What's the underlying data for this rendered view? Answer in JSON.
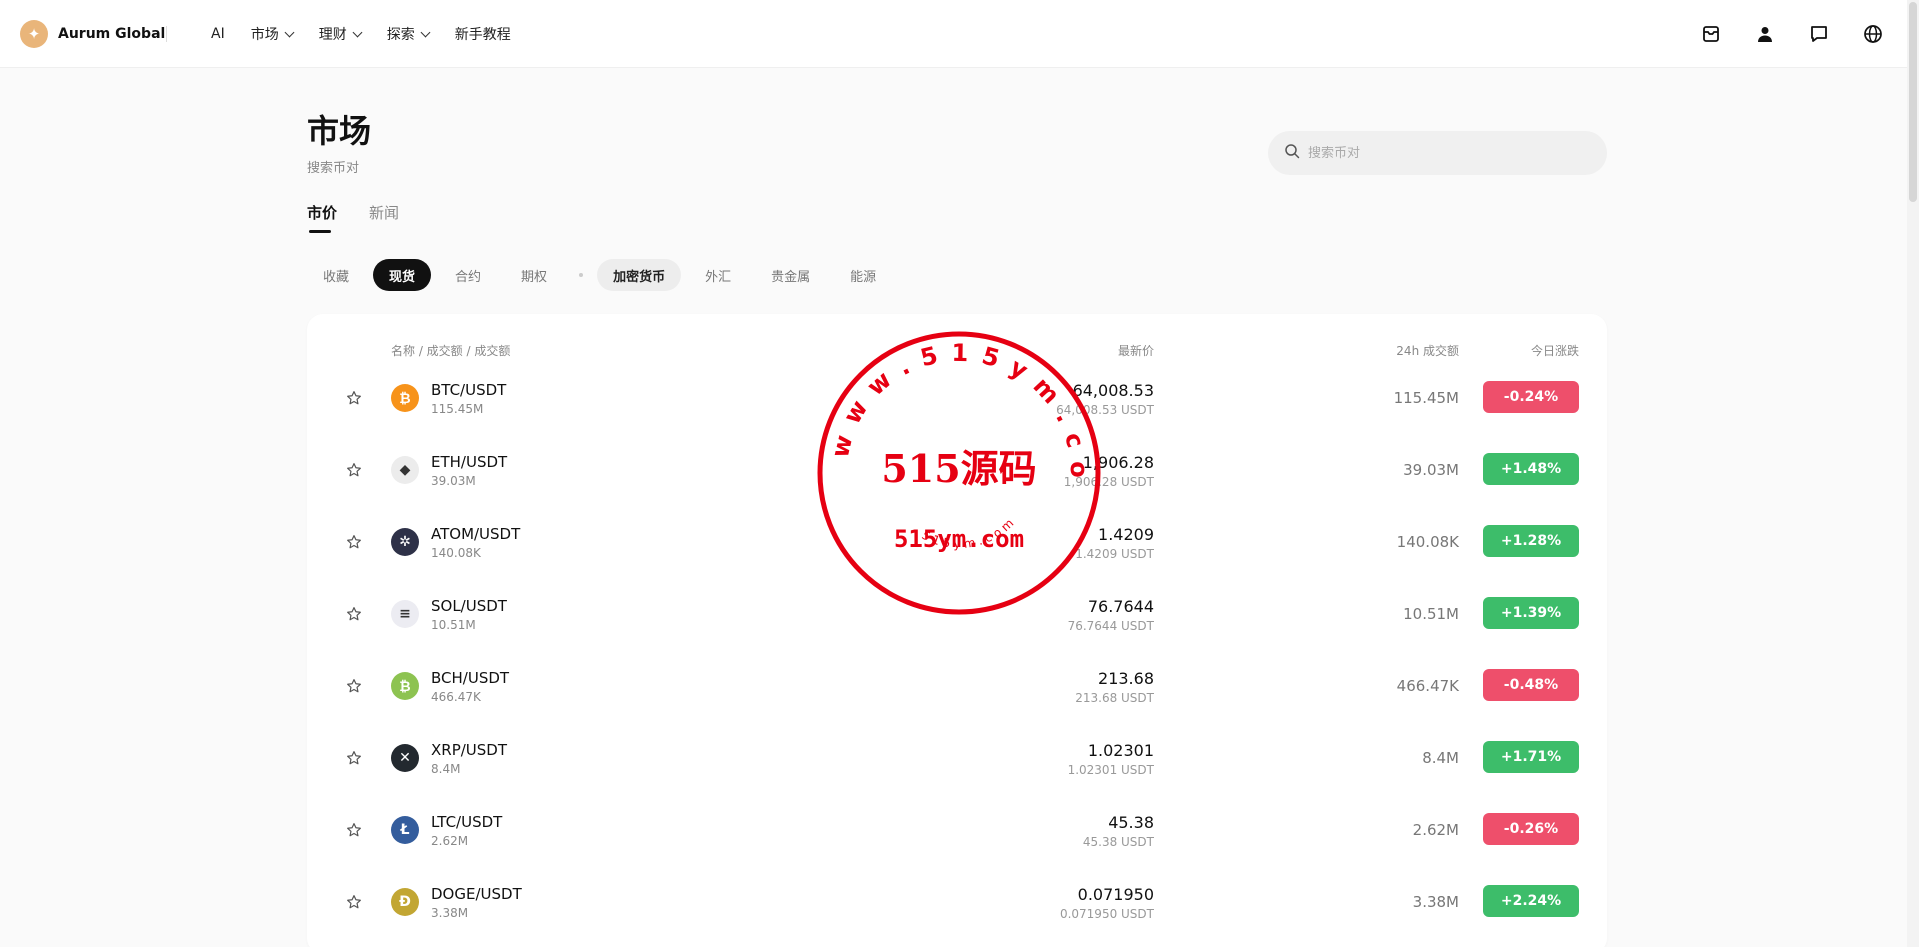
{
  "brand": {
    "name": "Aurum Global"
  },
  "nav": {
    "items": [
      {
        "label": "AI",
        "dropdown": false
      },
      {
        "label": "市场",
        "dropdown": true
      },
      {
        "label": "理财",
        "dropdown": true
      },
      {
        "label": "探索",
        "dropdown": true
      },
      {
        "label": "新手教程",
        "dropdown": false
      }
    ],
    "icons": [
      "mailbox-icon",
      "user-icon",
      "chat-icon",
      "globe-icon"
    ]
  },
  "header": {
    "title": "市场",
    "subtitle": "搜索币对",
    "search_placeholder": "搜索币对"
  },
  "tabs": [
    "市价",
    "新闻"
  ],
  "filters": {
    "left": [
      "收藏",
      "现货",
      "合约",
      "期权"
    ],
    "right": [
      "加密货币",
      "外汇",
      "贵金属",
      "能源"
    ]
  },
  "table": {
    "headers": {
      "name": "名称 / 成交额 / 成交额",
      "price": "最新价",
      "vol24": "24h 成交额",
      "change": "今日涨跌"
    },
    "rows": [
      {
        "pair": "BTC/USDT",
        "vol": "115.45M",
        "price": "64,008.53",
        "price_sub": "64,008.53 USDT",
        "vol24": "115.45M",
        "change": "-0.24%",
        "direction": "down",
        "coin_icon": "bitcoin-icon",
        "coin_color": "#f7931a",
        "glyph": "₿"
      },
      {
        "pair": "ETH/USDT",
        "vol": "39.03M",
        "price": "1,906.28",
        "price_sub": "1,906.28 USDT",
        "vol24": "39.03M",
        "change": "+1.48%",
        "direction": "up",
        "coin_icon": "ethereum-icon",
        "coin_color": "#ececec",
        "glyph": "◆"
      },
      {
        "pair": "ATOM/USDT",
        "vol": "140.08K",
        "price": "1.4209",
        "price_sub": "1.4209 USDT",
        "vol24": "140.08K",
        "change": "+1.28%",
        "direction": "up",
        "coin_icon": "cosmos-icon",
        "coin_color": "#2e3148",
        "glyph": "✲"
      },
      {
        "pair": "SOL/USDT",
        "vol": "10.51M",
        "price": "76.7644",
        "price_sub": "76.7644 USDT",
        "vol24": "10.51M",
        "change": "+1.39%",
        "direction": "up",
        "coin_icon": "solana-icon",
        "coin_color": "#ececf2",
        "glyph": "≡"
      },
      {
        "pair": "BCH/USDT",
        "vol": "466.47K",
        "price": "213.68",
        "price_sub": "213.68 USDT",
        "vol24": "466.47K",
        "change": "-0.48%",
        "direction": "down",
        "coin_icon": "bitcoin-cash-icon",
        "coin_color": "#8dc351",
        "glyph": "₿"
      },
      {
        "pair": "XRP/USDT",
        "vol": "8.4M",
        "price": "1.02301",
        "price_sub": "1.02301 USDT",
        "vol24": "8.4M",
        "change": "+1.71%",
        "direction": "up",
        "coin_icon": "xrp-icon",
        "coin_color": "#23292f",
        "glyph": "✕"
      },
      {
        "pair": "LTC/USDT",
        "vol": "2.62M",
        "price": "45.38",
        "price_sub": "45.38 USDT",
        "vol24": "2.62M",
        "change": "-0.26%",
        "direction": "down",
        "coin_icon": "litecoin-icon",
        "coin_color": "#345d9d",
        "glyph": "Ł"
      },
      {
        "pair": "DOGE/USDT",
        "vol": "3.38M",
        "price": "0.071950",
        "price_sub": "0.071950 USDT",
        "vol24": "3.38M",
        "change": "+2.24%",
        "direction": "up",
        "coin_icon": "dogecoin-icon",
        "coin_color": "#c2a633",
        "glyph": "Ð"
      }
    ]
  },
  "colors": {
    "up": "#3dbd6a",
    "down": "#ee4f6b",
    "accent": "#e9b57a"
  },
  "watermark": {
    "ring_text": "w w w . 5 1 5 y m . c o m",
    "center_text": "515源码",
    "domain_text": "515ym.com",
    "small_text": "5 1 5 y m . c o m",
    "color": "#e60012"
  }
}
